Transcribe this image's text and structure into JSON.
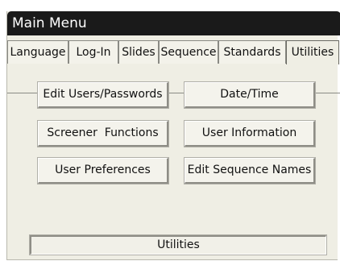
{
  "window": {
    "title": "Main Menu"
  },
  "tabs": [
    {
      "label": "Language"
    },
    {
      "label": "Log-In"
    },
    {
      "label": "Slides"
    },
    {
      "label": "Sequence"
    },
    {
      "label": "Standards"
    },
    {
      "label": "Utilities",
      "active": true
    }
  ],
  "buttons": {
    "edit_users_passwords": "Edit Users/Passwords",
    "date_time": "Date/Time",
    "screener_functions": "Screener  Functions",
    "user_information": "User Information",
    "user_preferences": "User Preferences",
    "edit_sequence_names": "Edit Sequence Names"
  },
  "status": {
    "text": "Utilities"
  },
  "colors": {
    "titlebar_bg": "#1a1a1a",
    "panel_bg": "#efeee4"
  }
}
